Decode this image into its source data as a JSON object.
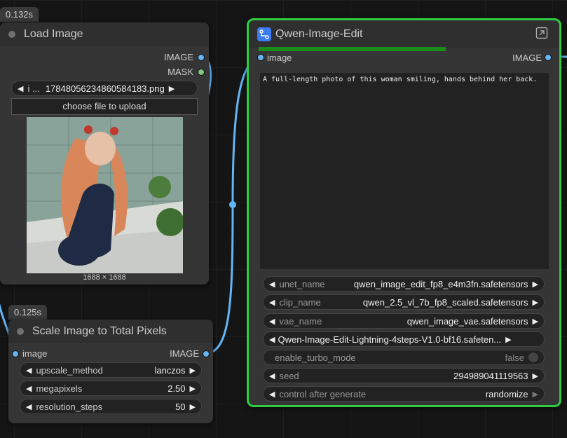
{
  "load_image": {
    "time": "0.132s",
    "title": "Load Image",
    "output_image": "IMAGE",
    "output_mask": "MASK",
    "file_prefix": "i ...",
    "file_name": "17848056234860584183.png",
    "upload_button": "choose file to upload",
    "dimensions": "1688 × 1688"
  },
  "scale_image": {
    "time": "0.125s",
    "title": "Scale Image to Total Pixels",
    "input_image": "image",
    "output_image": "IMAGE",
    "widgets": [
      {
        "label": "upscale_method",
        "value": "lanczos"
      },
      {
        "label": "megapixels",
        "value": "2.50"
      },
      {
        "label": "resolution_steps",
        "value": "50"
      }
    ]
  },
  "qwen": {
    "title": "Qwen-Image-Edit",
    "input_image": "image",
    "output_image": "IMAGE",
    "progress": 0.65,
    "prompt": "A full-length photo of this woman smiling, hands behind her back.",
    "widgets": [
      {
        "label": "unet_name",
        "value": "qwen_image_edit_fp8_e4m3fn.safetensors"
      },
      {
        "label": "clip_name",
        "value": "qwen_2.5_vl_7b_fp8_scaled.safetensors"
      },
      {
        "label": "vae_name",
        "value": "qwen_image_vae.safetensors"
      },
      {
        "label": "",
        "value": "Qwen-Image-Edit-Lightning-4steps-V1.0-bf16.safeten..."
      }
    ],
    "turbo": {
      "label": "enable_turbo_mode",
      "value": "false"
    },
    "seed": {
      "label": "seed",
      "value": "294989041119563"
    },
    "control": {
      "label": "control after generate",
      "value": "randomize"
    }
  },
  "colors": {
    "accent_green": "#2ecc40",
    "progress_green": "#1a8c1a",
    "link_blue": "#64b5f6",
    "icon_blue": "#3d7bf5"
  }
}
